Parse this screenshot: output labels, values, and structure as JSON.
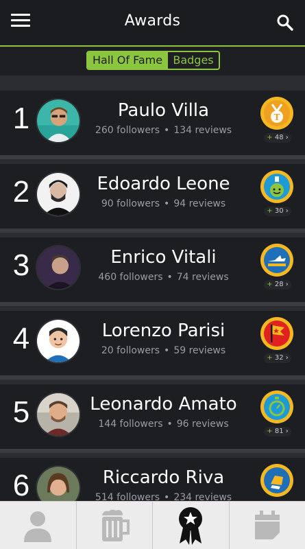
{
  "header": {
    "title": "Awards"
  },
  "toggle": {
    "active": "Hall Of Fame",
    "inactive": "Badges"
  },
  "separator": "•",
  "rows": [
    {
      "rank": "1",
      "name": "Paulo Villa",
      "followers": "260 followers",
      "reviews": "134 reviews",
      "badge_count": "48",
      "badge_color": "#f0a020"
    },
    {
      "rank": "2",
      "name": "Edoardo Leone",
      "followers": "90 followers",
      "reviews": "94 reviews",
      "badge_count": "30",
      "badge_color": "#1e9bd7"
    },
    {
      "rank": "3",
      "name": "Enrico Vitali",
      "followers": "460 followers",
      "reviews": "74 reviews",
      "badge_count": "28",
      "badge_color": "#1e6fb8"
    },
    {
      "rank": "4",
      "name": "Lorenzo Parisi",
      "followers": "20 followers",
      "reviews": "59 reviews",
      "badge_count": "32",
      "badge_color": "#e12020"
    },
    {
      "rank": "5",
      "name": "Leonardo Amato",
      "followers": "144 followers",
      "reviews": "96 reviews",
      "badge_count": "81",
      "badge_color": "#1e9bd7"
    },
    {
      "rank": "6",
      "name": "Riccardo Riva",
      "followers": "514 followers",
      "reviews": "234 reviews",
      "badge_count": "",
      "badge_color": "#1e6fb8"
    }
  ],
  "colors": {
    "accent": "#8cc63f",
    "header_bg": "#1b1c1f",
    "row_bg": "#1d1e22",
    "badge_gold": "#f5b820"
  },
  "tabs": [
    {
      "icon": "person-icon"
    },
    {
      "icon": "beer-mug-icon"
    },
    {
      "icon": "award-ribbon-icon",
      "active": true
    },
    {
      "icon": "calendar-icon"
    }
  ]
}
